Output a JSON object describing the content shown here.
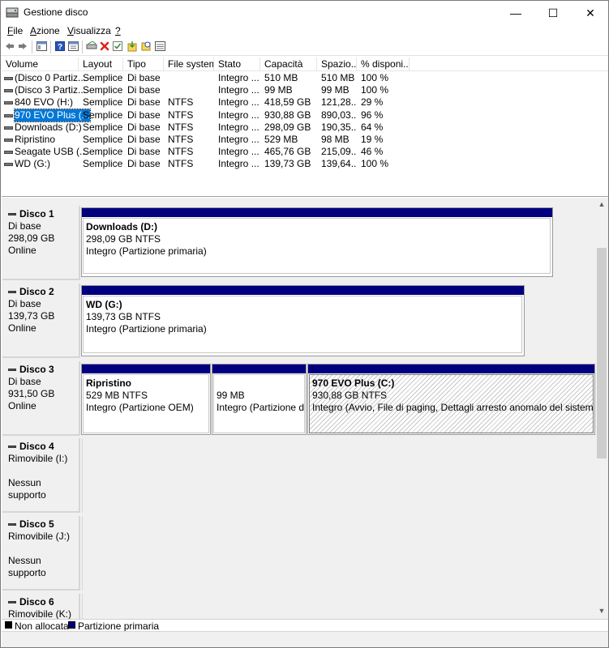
{
  "window": {
    "title": "Gestione disco",
    "minimize_glyph": "—",
    "maximize_glyph": "☐",
    "close_glyph": "✕"
  },
  "menu": [
    {
      "label": "File"
    },
    {
      "label": "Azione"
    },
    {
      "label": "Visualizza"
    },
    {
      "label": "?"
    }
  ],
  "toolbar": {
    "icons": [
      "back-icon",
      "forward-icon",
      "console-tree-icon",
      "help-icon",
      "properties-icon",
      "connect-icon",
      "delete-icon",
      "check-icon",
      "import-icon",
      "rescan-icon",
      "details-icon"
    ],
    "delete_color": "#e0221b"
  },
  "volume_list": {
    "columns": [
      "Volume",
      "Layout",
      "Tipo",
      "File system",
      "Stato",
      "Capacità",
      "Spazio...",
      "% disponi..."
    ],
    "rows": [
      {
        "volume": "(Disco 0 Partiz...",
        "layout": "Semplice",
        "tipo": "Di base",
        "fs": "",
        "stato": "Integro ...",
        "capacita": "510 MB",
        "spazio": "510 MB",
        "perc": "100 %"
      },
      {
        "volume": "(Disco 3 Partiz...",
        "layout": "Semplice",
        "tipo": "Di base",
        "fs": "",
        "stato": "Integro ...",
        "capacita": "99 MB",
        "spazio": "99 MB",
        "perc": "100 %"
      },
      {
        "volume": "840 EVO (H:)",
        "layout": "Semplice",
        "tipo": "Di base",
        "fs": "NTFS",
        "stato": "Integro ...",
        "capacita": "418,59 GB",
        "spazio": "121,28...",
        "perc": "29 %"
      },
      {
        "volume": "970 EVO Plus (...",
        "layout": "Semplice",
        "tipo": "Di base",
        "fs": "NTFS",
        "stato": "Integro ...",
        "capacita": "930,88 GB",
        "spazio": "890,03...",
        "perc": "96 %",
        "selected": true
      },
      {
        "volume": "Downloads (D:)",
        "layout": "Semplice",
        "tipo": "Di base",
        "fs": "NTFS",
        "stato": "Integro ...",
        "capacita": "298,09 GB",
        "spazio": "190,35...",
        "perc": "64 %"
      },
      {
        "volume": "Ripristino",
        "layout": "Semplice",
        "tipo": "Di base",
        "fs": "NTFS",
        "stato": "Integro ...",
        "capacita": "529 MB",
        "spazio": "98 MB",
        "perc": "19 %"
      },
      {
        "volume": "Seagate USB (...",
        "layout": "Semplice",
        "tipo": "Di base",
        "fs": "NTFS",
        "stato": "Integro ...",
        "capacita": "465,76 GB",
        "spazio": "215,09...",
        "perc": "46 %"
      },
      {
        "volume": "WD (G:)",
        "layout": "Semplice",
        "tipo": "Di base",
        "fs": "NTFS",
        "stato": "Integro ...",
        "capacita": "139,73 GB",
        "spazio": "139,64...",
        "perc": "100 %"
      }
    ]
  },
  "disks": [
    {
      "name": "Disco 1",
      "type": "Di base",
      "size": "298,09 GB",
      "status": "Online",
      "partitions": [
        {
          "title": "Downloads  (D:)",
          "line2": "298,09 GB NTFS",
          "line3": "Integro (Partizione primaria)"
        }
      ]
    },
    {
      "name": "Disco 2",
      "type": "Di base",
      "size": "139,73 GB",
      "status": "Online",
      "partitions": [
        {
          "title": "WD  (G:)",
          "line2": "139,73 GB NTFS",
          "line3": "Integro (Partizione primaria)"
        }
      ]
    },
    {
      "name": "Disco 3",
      "type": "Di base",
      "size": "931,50 GB",
      "status": "Online",
      "partitions": [
        {
          "title": "Ripristino",
          "line2": "529 MB NTFS",
          "line3": "Integro (Partizione OEM)"
        },
        {
          "title": "",
          "line2": "99 MB",
          "line3": "Integro (Partizione di s"
        },
        {
          "title": "970 EVO Plus  (C:)",
          "line2": "930,88 GB NTFS",
          "line3": "Integro (Avvio, File di paging, Dettagli arresto anomalo del sistema, Par"
        }
      ]
    },
    {
      "name": "Disco 4",
      "type": "Rimovibile (I:)",
      "size": "",
      "status": "Nessun supporto",
      "partitions": []
    },
    {
      "name": "Disco 5",
      "type": "Rimovibile (J:)",
      "size": "",
      "status": "Nessun supporto",
      "partitions": []
    },
    {
      "name": "Disco 6",
      "type": "Rimovibile (K:)",
      "size": "",
      "status": "",
      "partitions": []
    }
  ],
  "legend": [
    {
      "label": "Non allocata",
      "color": "#000000"
    },
    {
      "label": "Partizione primaria",
      "color": "#00007f"
    }
  ],
  "colors": {
    "partition_bar": "#00007f",
    "selection": "#0078d7"
  }
}
